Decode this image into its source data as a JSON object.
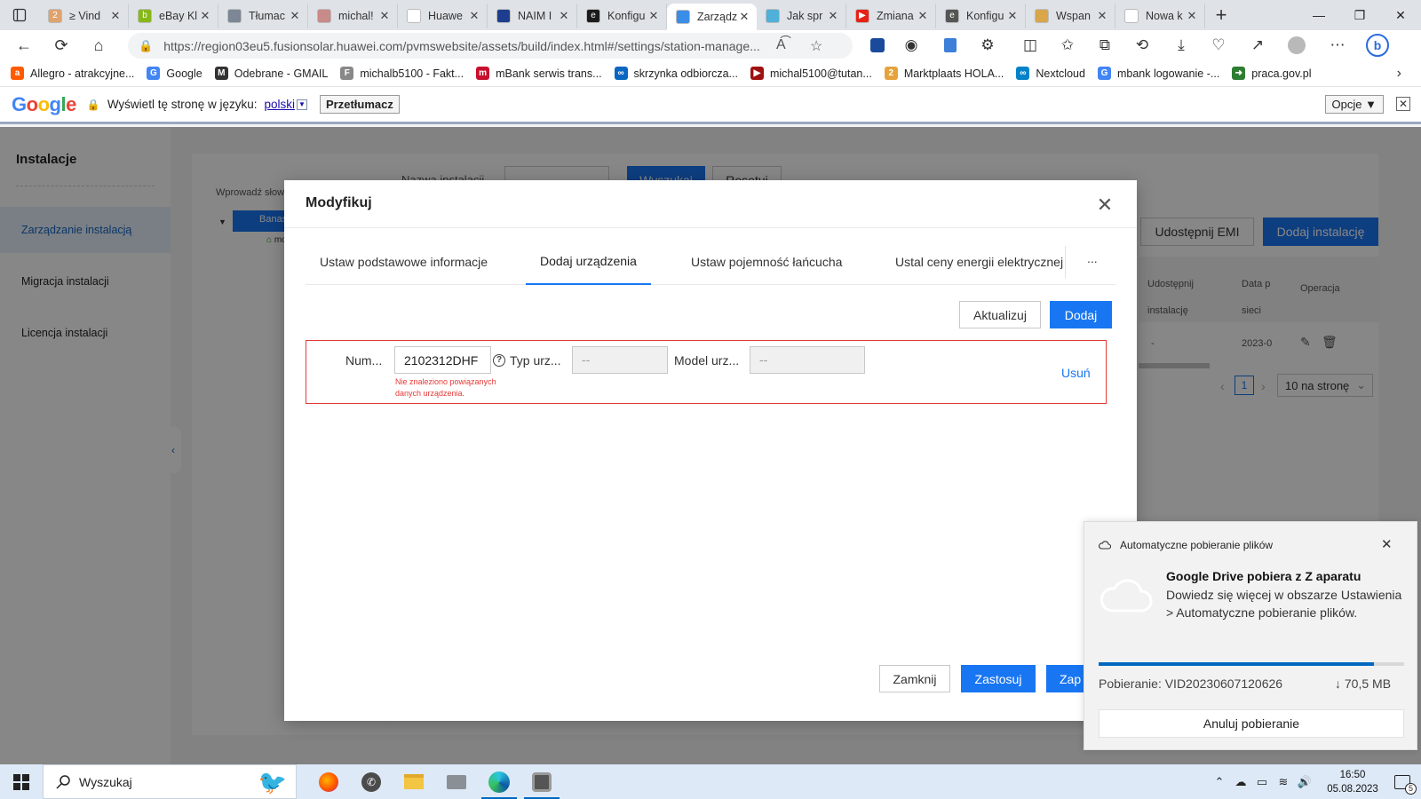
{
  "browser": {
    "tabs": [
      {
        "label": "≥ Vind",
        "color": "#e0a36e",
        "badge": "2"
      },
      {
        "label": "eBay Kl",
        "color": "#86b817",
        "badge": "b"
      },
      {
        "label": "Tłumac",
        "color": "#7b8794",
        "badge": ""
      },
      {
        "label": "michal!",
        "color": "#c98a8a",
        "badge": ""
      },
      {
        "label": "Huawe",
        "color": "#ffffff",
        "badge": ""
      },
      {
        "label": "NAIM I",
        "color": "#1d3e8f",
        "badge": ""
      },
      {
        "label": "Konfigu",
        "color": "#1b1b1b",
        "badge": "e"
      },
      {
        "label": "Zarządz",
        "color": "#3b8ee8",
        "badge": ""
      },
      {
        "label": "Jak spr",
        "color": "#4fb0d8",
        "badge": ""
      },
      {
        "label": "Zmiana",
        "color": "#e62117",
        "badge": "▶"
      },
      {
        "label": "Konfigu",
        "color": "#555555",
        "badge": "e"
      },
      {
        "label": "Wspan",
        "color": "#d9a64a",
        "badge": ""
      },
      {
        "label": "Nowa k",
        "color": "#ffffff",
        "badge": ""
      }
    ],
    "active_tab_index": 7,
    "url": "https://region03eu5.fusionsolar.huawei.com/pvmswebsite/assets/build/index.html#/settings/station-manage...",
    "bookmarks": [
      {
        "label": "Allegro - atrakcyjne...",
        "color": "#ff5a00",
        "letter": "a"
      },
      {
        "label": "Google",
        "color": "#4285f4",
        "letter": "G"
      },
      {
        "label": "Odebrane - GMAIL",
        "color": "#333333",
        "letter": "M"
      },
      {
        "label": "michalb5100 - Fakt...",
        "color": "#888888",
        "letter": "F"
      },
      {
        "label": "mBank serwis trans...",
        "color": "#c8102e",
        "letter": "m"
      },
      {
        "label": "skrzynka odbiorcza...",
        "color": "#0a66c2",
        "letter": "∞"
      },
      {
        "label": "michal5100@tutan...",
        "color": "#a01010",
        "letter": "▶"
      },
      {
        "label": "Marktplaats HOLA...",
        "color": "#e6a23c",
        "letter": "2"
      },
      {
        "label": "Nextcloud",
        "color": "#0082c9",
        "letter": "∞"
      },
      {
        "label": "mbank logowanie -...",
        "color": "#4285f4",
        "letter": "G"
      },
      {
        "label": "praca.gov.pl",
        "color": "#2e7d32",
        "letter": "➜"
      }
    ]
  },
  "translate_bar": {
    "logo": "Google",
    "text": "Wyświetl tę stronę w języku:",
    "language": "polski",
    "translate_button": "Przetłumacz",
    "options_button": "Opcje ▼"
  },
  "sidebar": {
    "title": "Instalacje",
    "items": [
      {
        "label": "Zarządzanie instalacją",
        "active": true
      },
      {
        "label": "Migracja instalacji",
        "active": false
      },
      {
        "label": "Licencja instalacji",
        "active": false
      }
    ]
  },
  "background": {
    "search_label": "Wprowadź słowo",
    "name_label": "Nazwa instalacji",
    "search_button": "Wyszukaj",
    "reset_button": "Resetuj",
    "tree_root": "Banas",
    "tree_child": "moj",
    "share_emi_button": "Udostępnij EMI",
    "add_installation_button": "Dodaj instalację",
    "columns": [
      "Udostępnij instalację",
      "Data p sieci",
      "Operacja"
    ],
    "row_values": [
      "-",
      "2023-0"
    ],
    "page_number": "1",
    "page_size": "10 na stronę"
  },
  "modal": {
    "title": "Modyfikuj",
    "tabs": [
      {
        "label": "Ustaw podstawowe informacje"
      },
      {
        "label": "Dodaj urządzenia"
      },
      {
        "label": "Ustaw pojemność łańcucha"
      },
      {
        "label": "Ustal ceny energii elektrycznej"
      }
    ],
    "active_tab": 1,
    "more": "...",
    "update_button": "Aktualizuj",
    "add_button": "Dodaj",
    "device_row": {
      "number_label": "Num...",
      "number_value": "2102312DHF",
      "error_text": "Nie znaleziono powiązanych danych urządzenia.",
      "type_label": "Typ urz...",
      "type_value": "--",
      "model_label": "Model urz...",
      "model_value": "--",
      "delete_link": "Usuń"
    },
    "close_button": "Zamknij",
    "apply_button": "Zastosuj",
    "save_button": "Zap"
  },
  "notification": {
    "header": "Automatyczne pobieranie plików",
    "title": "Google Drive pobiera z Z aparatu",
    "body": "Dowiedz się więcej w obszarze Ustawienia > Automatyczne pobieranie plików.",
    "download_label": "Pobieranie: VID20230607120626",
    "size": "↓ 70,5 MB",
    "progress": 0.9,
    "cancel_button": "Anuluj pobieranie"
  },
  "taskbar": {
    "search_placeholder": "Wyszukaj",
    "apps": [
      "firefox-icon",
      "whatsapp-icon",
      "file-explorer-icon",
      "printer-icon",
      "edge-icon",
      "settings-app-icon"
    ],
    "time": "16:50",
    "date": "05.08.2023",
    "notification_count": "5"
  }
}
